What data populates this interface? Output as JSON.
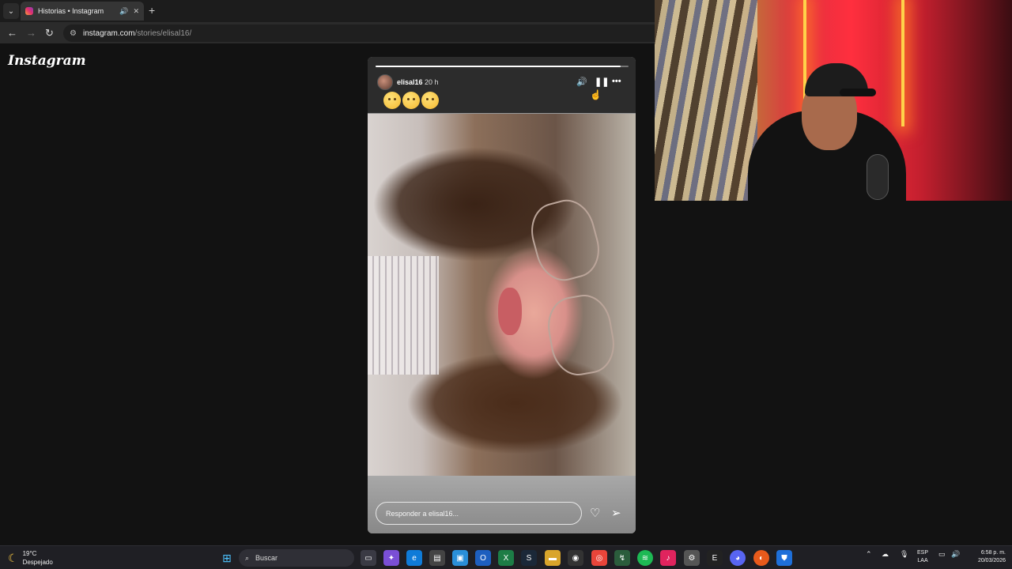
{
  "browser": {
    "tab_title": "Historias • Instagram",
    "url_host": "instagram.com",
    "url_path": "/stories/elisal16/"
  },
  "page": {
    "logo": "Instagram"
  },
  "story": {
    "username": "elisal16",
    "time_ago": "20 h",
    "progress": 0.97,
    "reply_placeholder": "Responder a elisal16...",
    "emojis": [
      "flushed-face",
      "weary-face",
      "relieved-face"
    ]
  },
  "taskbar": {
    "weather_temp": "19°C",
    "weather_desc": "Despejado",
    "search_label": "Buscar",
    "lang_top": "ESP",
    "lang_bottom": "LAA",
    "time": "6:58 p. m.",
    "date": "20/03/2026"
  },
  "colors": {
    "page_bg": "#121212",
    "ig_gradient": [
      "#f9a13a",
      "#e3306c",
      "#8a3ab9"
    ]
  }
}
